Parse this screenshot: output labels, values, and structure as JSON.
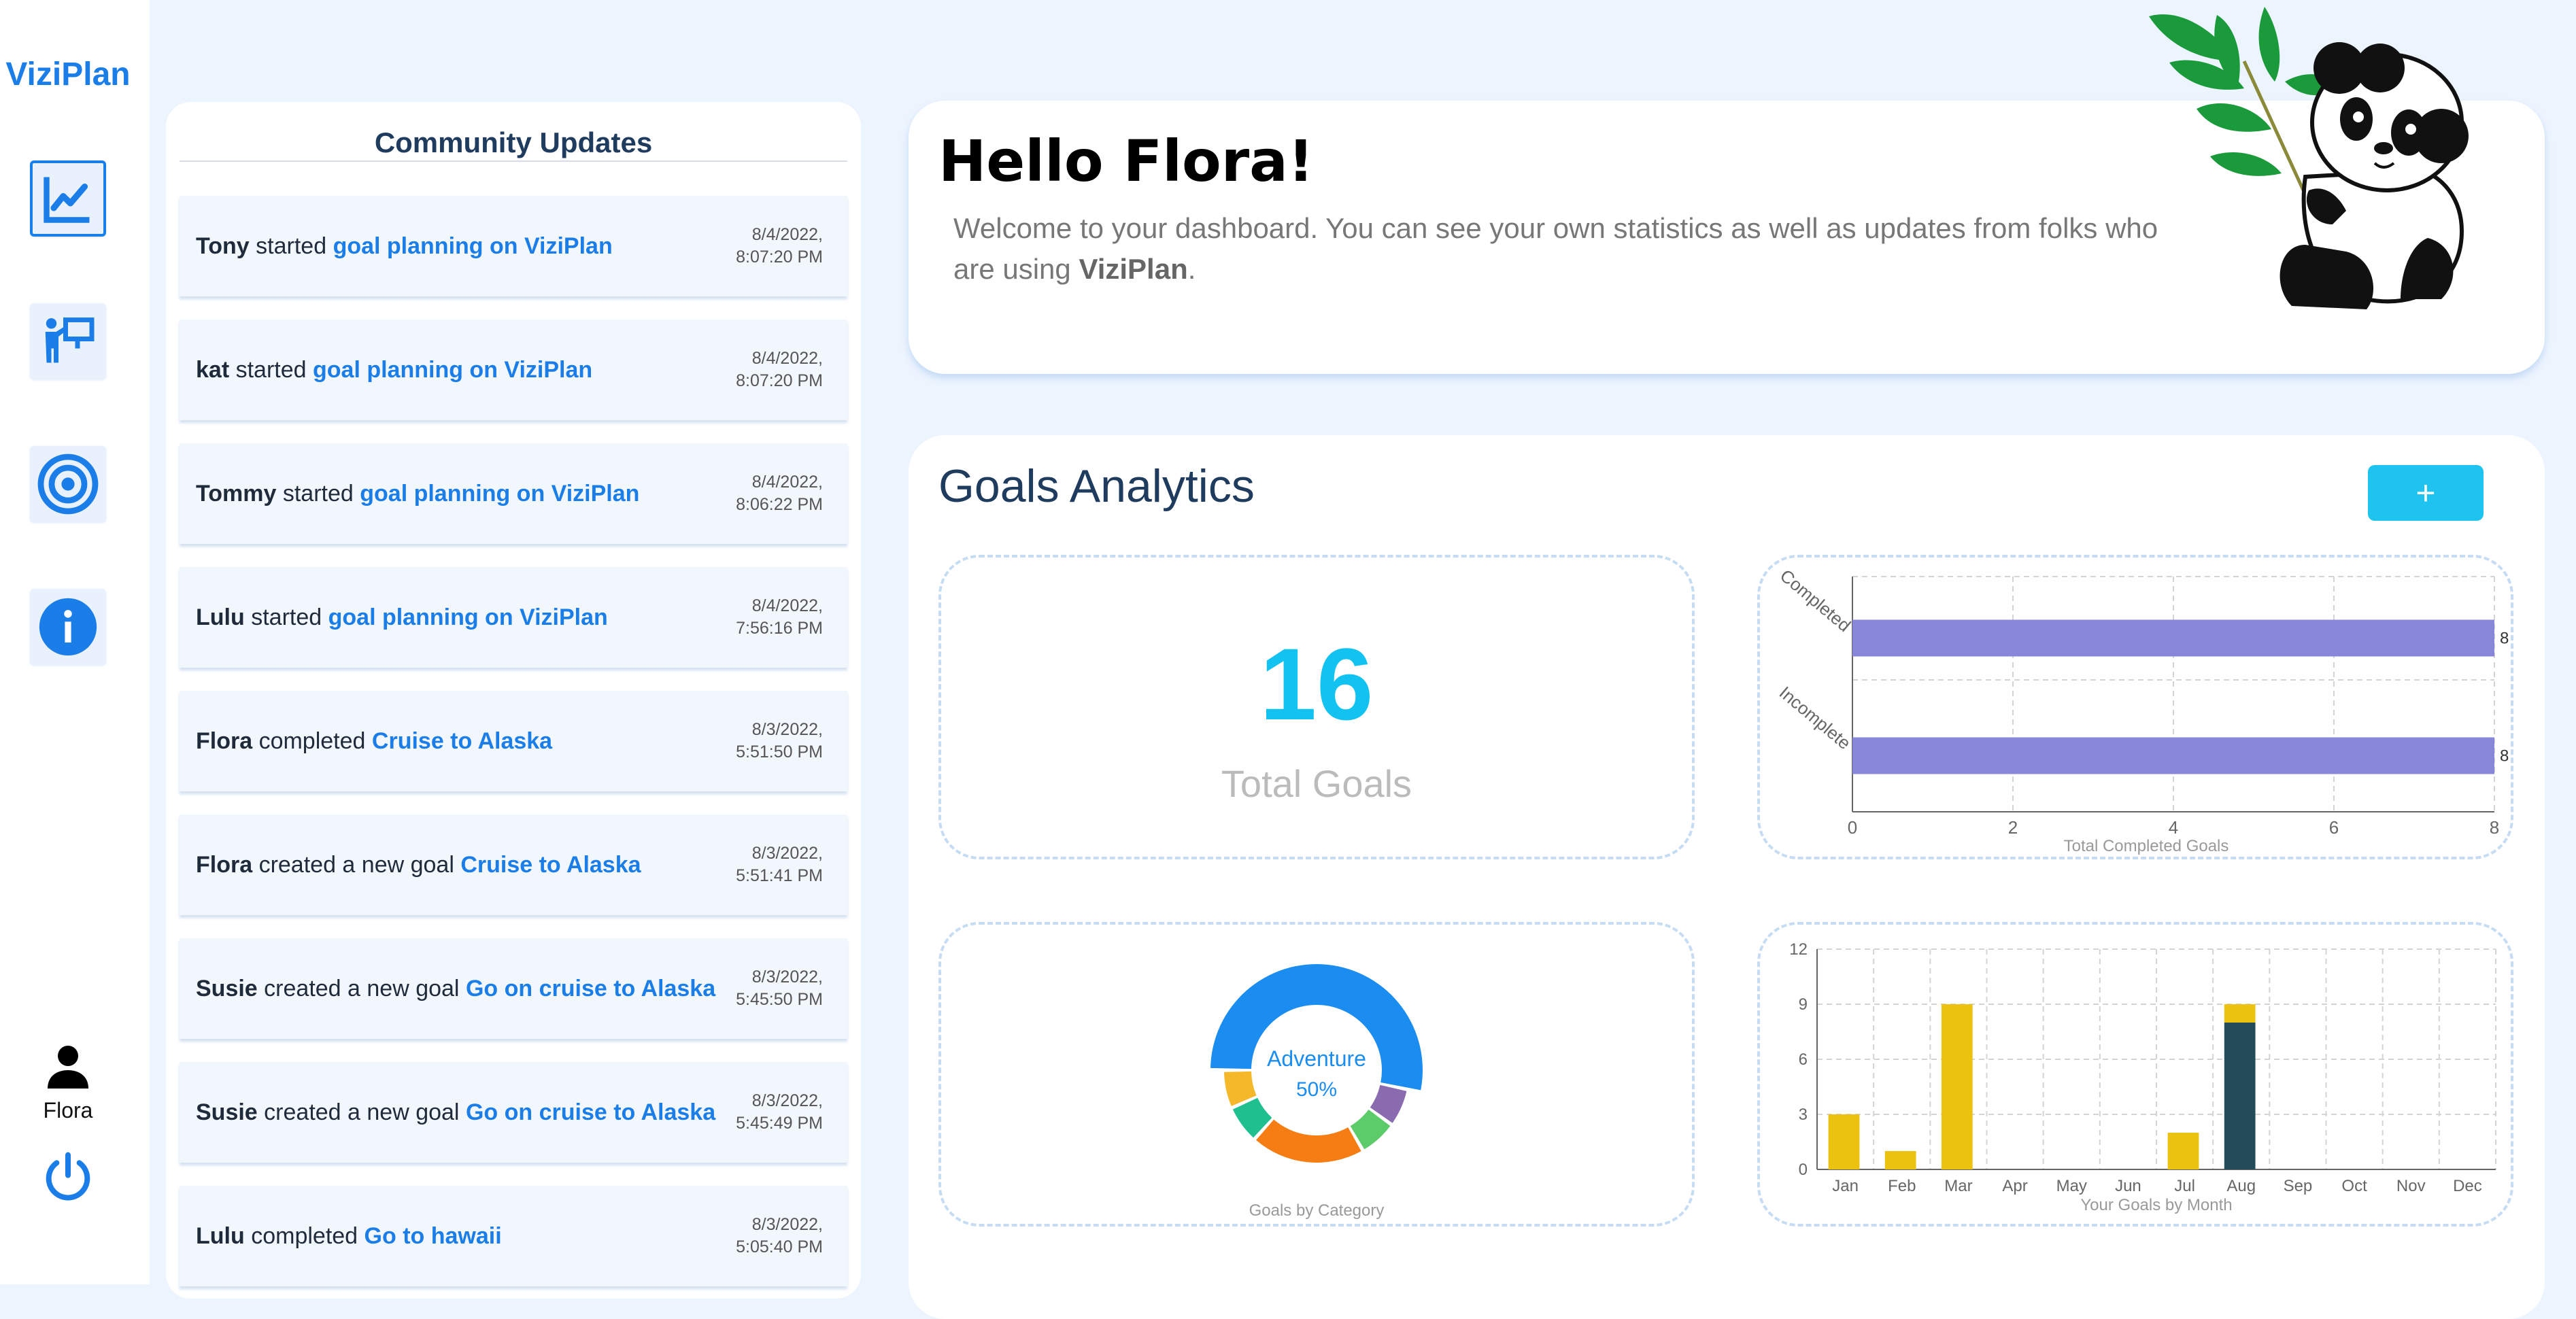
{
  "app": {
    "brand": "ViziPlan"
  },
  "sidebar": {
    "items": [
      {
        "name": "analytics",
        "icon": "chart-line-icon"
      },
      {
        "name": "presentation",
        "icon": "presenter-icon"
      },
      {
        "name": "goals",
        "icon": "target-icon"
      },
      {
        "name": "info",
        "icon": "info-icon"
      }
    ],
    "user_name": "Flora"
  },
  "community": {
    "title": "Community Updates",
    "updates": [
      {
        "user": "Tony",
        "action": "started",
        "goal": "goal planning on ViziPlan",
        "date": "8/4/2022,",
        "time": "8:07:20 PM"
      },
      {
        "user": "kat",
        "action": "started",
        "goal": "goal planning on ViziPlan",
        "date": "8/4/2022,",
        "time": "8:07:20 PM"
      },
      {
        "user": "Tommy",
        "action": "started",
        "goal": "goal planning on ViziPlan",
        "date": "8/4/2022,",
        "time": "8:06:22 PM"
      },
      {
        "user": "Lulu",
        "action": "started",
        "goal": "goal planning on ViziPlan",
        "date": "8/4/2022,",
        "time": "7:56:16 PM"
      },
      {
        "user": "Flora",
        "action": "completed",
        "goal": "Cruise to Alaska",
        "date": "8/3/2022,",
        "time": "5:51:50 PM"
      },
      {
        "user": "Flora",
        "action": "created a new goal",
        "goal": "Cruise to Alaska",
        "date": "8/3/2022,",
        "time": "5:51:41 PM"
      },
      {
        "user": "Susie",
        "action": "created a new goal",
        "goal": "Go on cruise to Alaska",
        "date": "8/3/2022,",
        "time": "5:45:50 PM"
      },
      {
        "user": "Susie",
        "action": "created a new goal",
        "goal": "Go on cruise to Alaska",
        "date": "8/3/2022,",
        "time": "5:45:49 PM"
      },
      {
        "user": "Lulu",
        "action": "completed",
        "goal": "Go to hawaii",
        "date": "8/3/2022,",
        "time": "5:05:40 PM"
      }
    ]
  },
  "welcome": {
    "greeting": "Hello Flora!",
    "text_before": "Welcome to your dashboard. You can see your own statistics as well as updates from folks who are using ",
    "text_brand": "ViziPlan",
    "text_after": "."
  },
  "analytics": {
    "title": "Goals Analytics",
    "add_label": "+",
    "total_value": "16",
    "total_label": "Total Goals"
  },
  "colors": {
    "accent": "#1b7ee8",
    "cyan": "#12c2f0",
    "bar_purple": "#8886d9",
    "bar_yellow": "#eac20f",
    "bar_dark": "#234b5a"
  },
  "chart_data": [
    {
      "type": "bar",
      "orientation": "horizontal",
      "categories": [
        "Completed",
        "Incomplete"
      ],
      "values": [
        8,
        8
      ],
      "data_labels": [
        "8",
        "8"
      ],
      "xlabel": "Total Completed Goals",
      "xlim": [
        0,
        8
      ],
      "xticks": [
        "0",
        "2",
        "4",
        "6",
        "8"
      ],
      "grid": true
    },
    {
      "type": "pie",
      "style": "donut",
      "center_label": "Adventure",
      "center_value": "50%",
      "xlabel": "Goals by Category",
      "slices": [
        {
          "label": "Adventure",
          "value": 50,
          "color": "#1b8cf0"
        },
        {
          "label": "",
          "value": 6.25,
          "color": "#8a6bb0"
        },
        {
          "label": "",
          "value": 6.25,
          "color": "#5ccc6a"
        },
        {
          "label": "",
          "value": 18.75,
          "color": "#f57d14"
        },
        {
          "label": "",
          "value": 6.25,
          "color": "#1fbf8f"
        },
        {
          "label": "",
          "value": 6.25,
          "color": "#f5b82a"
        }
      ]
    },
    {
      "type": "bar",
      "stacked": true,
      "categories": [
        "Jan",
        "Feb",
        "Mar",
        "Apr",
        "May",
        "Jun",
        "Jul",
        "Aug",
        "Sep",
        "Oct",
        "Nov",
        "Dec"
      ],
      "series": [
        {
          "values": [
            0,
            0,
            0,
            0,
            0,
            0,
            0,
            8,
            0,
            0,
            0,
            0
          ],
          "color": "#234b5a"
        },
        {
          "values": [
            3,
            1,
            9,
            0,
            0,
            0,
            2,
            1,
            0,
            0,
            0,
            0
          ],
          "color": "#eac20f"
        }
      ],
      "xlabel": "Your Goals by Month",
      "ylim": [
        0,
        12
      ],
      "yticks": [
        "0",
        "3",
        "6",
        "9",
        "12"
      ],
      "grid": true
    }
  ]
}
